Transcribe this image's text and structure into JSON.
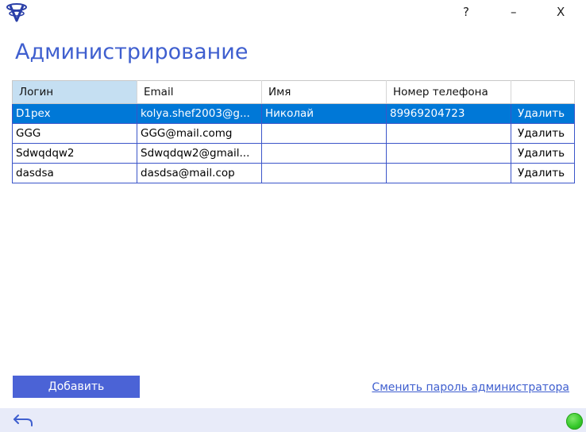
{
  "window": {
    "help_label": "?",
    "minimize_label": "–",
    "close_label": "X"
  },
  "page": {
    "title": "Администрирование"
  },
  "table": {
    "columns": [
      "Логин",
      "Email",
      "Имя",
      "Номер телефона",
      ""
    ],
    "rows": [
      {
        "login": "D1pex",
        "email": "kolya.shef2003@g...",
        "name": "Николай",
        "phone": "89969204723",
        "action": "Удалить",
        "selected": true
      },
      {
        "login": "GGG",
        "email": "GGG@mail.comg",
        "name": "",
        "phone": "",
        "action": "Удалить",
        "selected": false
      },
      {
        "login": "Sdwqdqw2",
        "email": "Sdwqdqw2@gmail...",
        "name": "",
        "phone": "",
        "action": "Удалить",
        "selected": false
      },
      {
        "login": "dasdsa",
        "email": "dasdsa@mail.cop",
        "name": "",
        "phone": "",
        "action": "Удалить",
        "selected": false
      }
    ]
  },
  "footer": {
    "add_label": "Добавить",
    "change_password_link": "Сменить пароль администратора"
  },
  "statusbar": {
    "back_icon": "back-arrow-icon",
    "status": "online",
    "status_color": "#35c82a"
  },
  "colors": {
    "accent": "#3f5fcf",
    "button": "#4b63d6",
    "selection": "#0078d7",
    "sorted_header": "#c5dff2",
    "statusbar": "#e8ebf9"
  }
}
